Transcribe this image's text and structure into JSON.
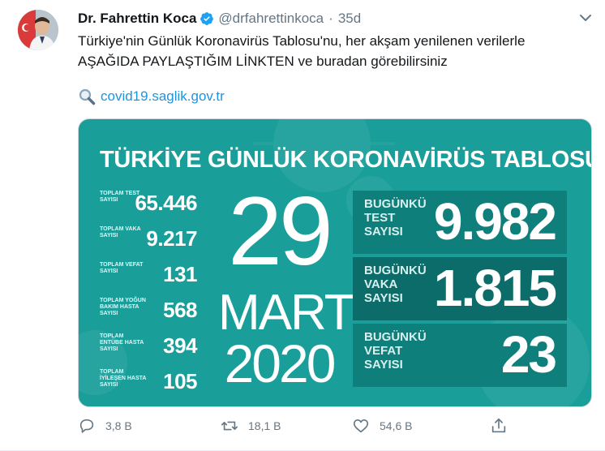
{
  "tweet": {
    "author_name": "Dr. Fahrettin Koca",
    "handle": "@drfahrettinkoca",
    "separator": "·",
    "time": "35d",
    "text_line1": "Türkiye'nin Günlük Koronavirüs Tablosu'nu, her akşam yenilenen verilerle",
    "text_line2": "AŞAĞIDA PAYLAŞTIĞIM LİNKTEN ve buradan görebilirsiniz",
    "link_emoji": "magnifying-glass-icon",
    "link_text": "covid19.saglik.gov.tr"
  },
  "card": {
    "title": "TÜRKİYE GÜNLÜK KORONAVİRÜS TABLOSU",
    "background_color": "#1a9e9a",
    "stats": [
      {
        "label": "TOPLAM TEST SAYISI",
        "value": "65.446"
      },
      {
        "label": "TOPLAM VAKA SAYISI",
        "value": "9.217"
      },
      {
        "label": "TOPLAM VEFAT SAYISI",
        "value": "131"
      },
      {
        "label": "TOPLAM YOĞUN BAKIM HASTA SAYISI",
        "value": "568"
      },
      {
        "label": "TOPLAM ENTÜBE HASTA SAYISI",
        "value": "394"
      },
      {
        "label": "TOPLAM İYİLEŞEN HASTA SAYISI",
        "value": "105"
      }
    ],
    "date": {
      "day": "29",
      "month": "MART",
      "year": "2020"
    },
    "today": [
      {
        "label": "BUGÜNKÜ TEST SAYISI",
        "value": "9.982"
      },
      {
        "label": "BUGÜNKÜ VAKA SAYISI",
        "value": "1.815"
      },
      {
        "label": "BUGÜNKÜ VEFAT SAYISI",
        "value": "23"
      }
    ]
  },
  "actions": {
    "reply_count": "3,8 B",
    "retweet_count": "18,1 B",
    "like_count": "54,6 B"
  },
  "colors": {
    "link": "#1b95e0",
    "verified": "#1da1f2",
    "muted": "#657786"
  }
}
